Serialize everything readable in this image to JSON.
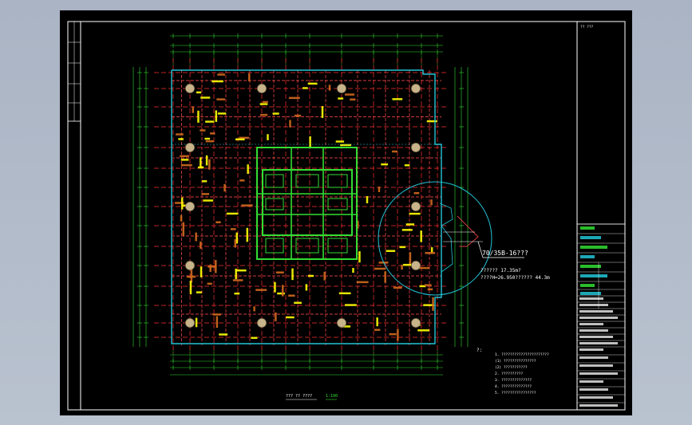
{
  "drawing": {
    "callout_label": "70/35B-16???",
    "area_line1": "?????? 17.35m?",
    "area_line2": "????H=26.950?????? 44.3m",
    "question_mark": "?:",
    "bottom_caption": "??? ?? ????",
    "bottom_scale": "1:100",
    "title_block_header": "?? ???",
    "notes": [
      "1. ??????????????????????",
      "   (1) ???????????????",
      "   (2) ???????????",
      "2. ??????????",
      "3. ??????????????",
      "4. ??????????????",
      "5. ????????????????"
    ]
  },
  "colors": {
    "background": "#000000",
    "axis": "#ff3030",
    "beam": "#d23b3b",
    "column": "#c8b48a",
    "core_wall": "#33dd33",
    "outline": "#22c4d6",
    "dimension": "#33dd33",
    "label_yellow": "#ffff00",
    "label_orange": "#d2691e",
    "frame": "#ffffff"
  }
}
